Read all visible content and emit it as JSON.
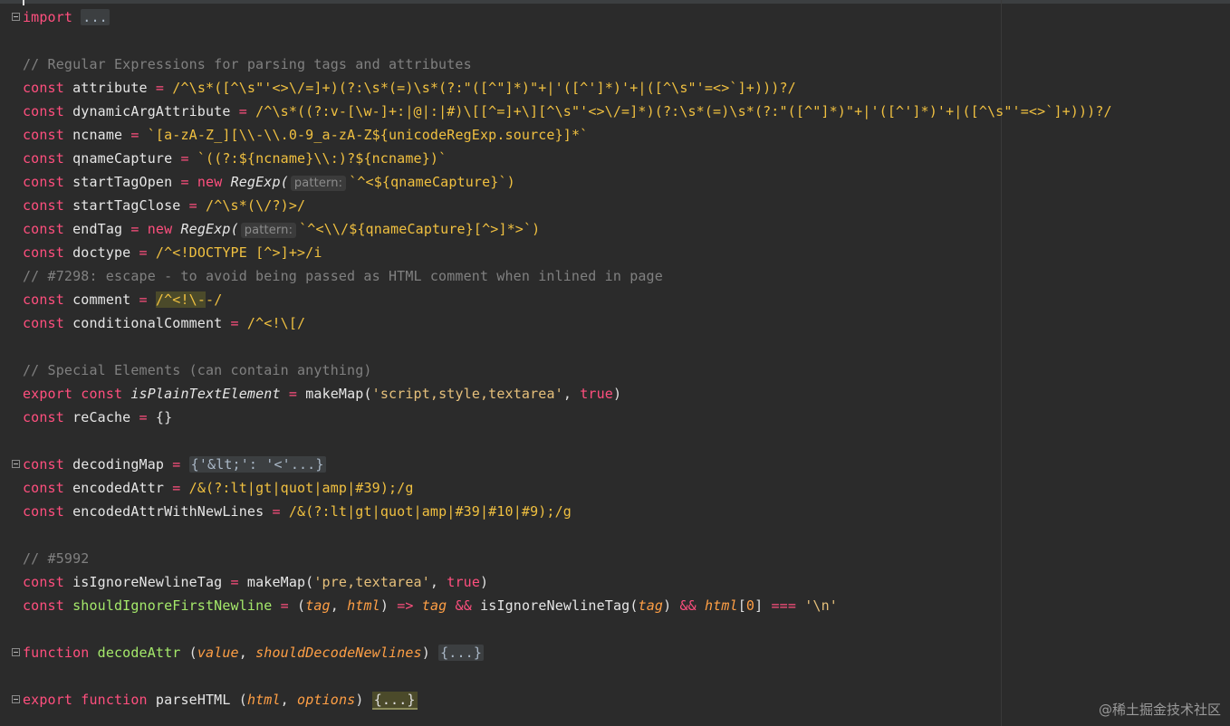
{
  "editor": {
    "lines": {
      "l1": [
        "import",
        "..."
      ],
      "l3": "// Regular Expressions for parsing tags and attributes",
      "l4": [
        "const",
        "attribute",
        "=",
        "/^\\s*([^\\s\"'<>\\/=]+)(?:\\s*(=)\\s*(?:\"([^\"]*)\"+|'([^']*)'+|([^\\s\"'=<>`]+)))?/"
      ],
      "l5": [
        "const",
        "dynamicArgAttribute",
        "=",
        "/^\\s*((?:v-[\\w-]+:|@|:|#)\\[[^=]+\\][^\\s\"'<>\\/=]*)(?:\\s*(=)\\s*(?:\"([^\"]*)\"+|'([^']*)'+|([^\\s\"'=<>`]+)))?/"
      ],
      "l6": [
        "const",
        "ncname",
        "=",
        "`[a-zA-Z_][\\\\-\\\\.0-9_a-zA-Z${unicodeRegExp.source}]*`"
      ],
      "l7": [
        "const",
        "qnameCapture",
        "=",
        "`((?:${ncname}\\\\:)?${ncname})`"
      ],
      "l8": [
        "const",
        "startTagOpen",
        "=",
        "new",
        "RegExp(",
        "pattern:",
        "`^<${qnameCapture}`)"
      ],
      "l9": [
        "const",
        "startTagClose",
        "=",
        "/^\\s*(\\/?)>/"
      ],
      "l10": [
        "const",
        "endTag",
        "=",
        "new",
        "RegExp(",
        "pattern:",
        "`^<\\\\/${qnameCapture}[^>]*>`)"
      ],
      "l11": [
        "const",
        "doctype",
        "=",
        "/^<!DOCTYPE [^>]+>/i"
      ],
      "l12": "// #7298: escape - to avoid being passed as HTML comment when inlined in page",
      "l13": [
        "const",
        "comment",
        "=",
        "/^<!\\-",
        "-/"
      ],
      "l14": [
        "const",
        "conditionalComment",
        "=",
        "/^<!\\[/"
      ],
      "l16": "// Special Elements (can contain anything)",
      "l17": [
        "export",
        "const",
        "isPlainTextElement",
        "=",
        "makeMap(",
        "'script,style,textarea'",
        ",",
        "true",
        ")"
      ],
      "l18": [
        "const",
        "reCache",
        "=",
        "{}"
      ],
      "l20": [
        "const",
        "decodingMap",
        "=",
        "{'&lt;': '<'...}"
      ],
      "l21": [
        "const",
        "encodedAttr",
        "=",
        "/&(?:lt|gt|quot|amp|#39);/g"
      ],
      "l22": [
        "const",
        "encodedAttrWithNewLines",
        "=",
        "/&(?:lt|gt|quot|amp|#39|#10|#9);/g"
      ],
      "l24": "// #5992",
      "l25": [
        "const",
        "isIgnoreNewlineTag",
        "=",
        "makeMap(",
        "'pre,textarea'",
        ",",
        "true",
        ")"
      ],
      "l26": [
        "const",
        "shouldIgnoreFirstNewline",
        "=",
        "(",
        "tag",
        ",",
        "html",
        ")",
        "=>",
        "tag",
        "&&",
        "isIgnoreNewlineTag(",
        "tag",
        ")",
        "&&",
        "html",
        "[",
        "0",
        "]",
        "===",
        "'\\n'"
      ],
      "l28": [
        "function",
        "decodeAttr",
        "(",
        "value",
        ",",
        "shouldDecodeNewlines",
        ")",
        "{...}"
      ],
      "l30": [
        "export",
        "function",
        "parseHTML",
        "(",
        "html",
        ",",
        "options",
        ")",
        "{...}"
      ]
    }
  },
  "watermark": "@稀土掘金技术社区",
  "colors": {
    "background": "#2b2b2b",
    "keyword": "#ff4f7e",
    "regex": "#f0c040",
    "comment": "#808080",
    "function": "#a4e86a",
    "param": "#ff9f45"
  }
}
